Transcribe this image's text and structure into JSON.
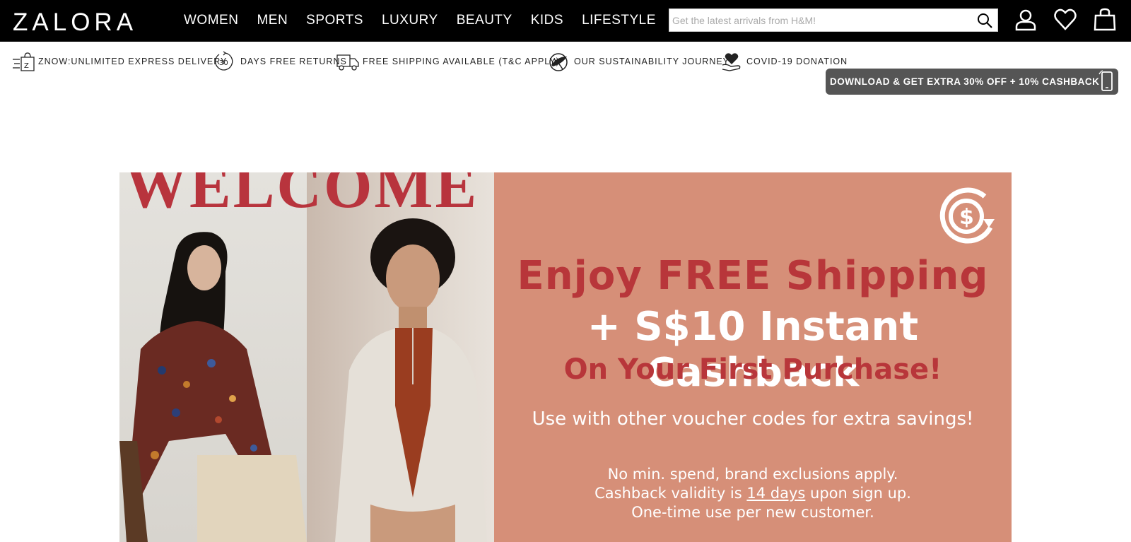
{
  "header": {
    "logo": "ZALORA",
    "nav": [
      "WOMEN",
      "MEN",
      "SPORTS",
      "LUXURY",
      "BEAUTY",
      "KIDS",
      "LIFESTYLE"
    ],
    "search_placeholder": "Get the latest arrivals from H&M!"
  },
  "usp": [
    {
      "icon": "express-bag-icon",
      "label": "ZNOW:UNLIMITED EXPRESS DELIVERY"
    },
    {
      "icon": "thirty-days-icon",
      "label": "DAYS FREE RETURNS"
    },
    {
      "icon": "delivery-truck-icon",
      "label": "FREE SHIPPING AVAILABLE (T&C APPLY)"
    },
    {
      "icon": "globe-leaf-icon",
      "label": "OUR SUSTAINABILITY JOURNEY"
    },
    {
      "icon": "heart-hand-icon",
      "label": "COVID-19 DONATION"
    }
  ],
  "app_banner": "DOWNLOAD & GET EXTRA 30% OFF + 10% CASHBACK",
  "hero": {
    "welcome": "WELCOME",
    "line1": "Enjoy FREE Shipping",
    "line2": "+ S$10  Instant Cashback",
    "line3": "On Your First Purchase!",
    "line4": "Use with other voucher codes for extra savings!",
    "fine1": "No min. spend, brand exclusions apply.",
    "fine2_pre": "Cashback validity is ",
    "fine2_link": "14 days",
    "fine2_post": " upon sign up.",
    "fine3": "One-time use per new customer."
  },
  "colors": {
    "accent_red": "#b8363a",
    "promo_bg": "#d68f78",
    "header_bg": "#000000"
  }
}
